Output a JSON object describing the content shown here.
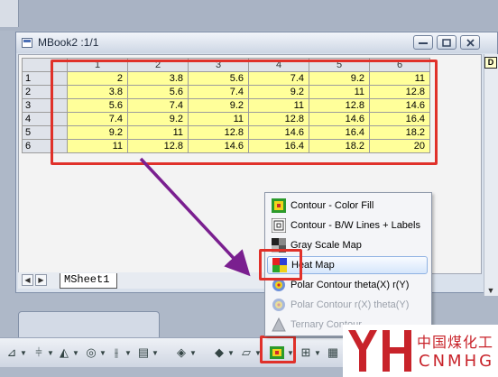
{
  "window": {
    "title": "MBook2 :1/1",
    "d_button": "D",
    "sheet_tab": "MSheet1"
  },
  "sheet": {
    "columns": [
      "1",
      "2",
      "3",
      "4",
      "5",
      "6"
    ],
    "rows": [
      {
        "label": "1",
        "values": [
          "2",
          "3.8",
          "5.6",
          "7.4",
          "9.2",
          "11"
        ]
      },
      {
        "label": "2",
        "values": [
          "3.8",
          "5.6",
          "7.4",
          "9.2",
          "11",
          "12.8"
        ]
      },
      {
        "label": "3",
        "values": [
          "5.6",
          "7.4",
          "9.2",
          "11",
          "12.8",
          "14.6"
        ]
      },
      {
        "label": "4",
        "values": [
          "7.4",
          "9.2",
          "11",
          "12.8",
          "14.6",
          "16.4"
        ]
      },
      {
        "label": "5",
        "values": [
          "9.2",
          "11",
          "12.8",
          "14.6",
          "16.4",
          "18.2"
        ]
      },
      {
        "label": "6",
        "values": [
          "11",
          "12.8",
          "14.6",
          "16.4",
          "18.2",
          "20"
        ]
      }
    ]
  },
  "menu": {
    "items": [
      {
        "label": "Contour - Color Fill",
        "icon": "contour-color-fill-icon",
        "enabled": true,
        "highlighted": false
      },
      {
        "label": "Contour - B/W Lines + Labels",
        "icon": "contour-bw-lines-icon",
        "enabled": true,
        "highlighted": false
      },
      {
        "label": "Gray Scale Map",
        "icon": "gray-scale-map-icon",
        "enabled": true,
        "highlighted": false
      },
      {
        "label": "Heat Map",
        "icon": "heat-map-icon",
        "enabled": true,
        "highlighted": true
      },
      {
        "label": "Polar Contour theta(X) r(Y)",
        "icon": "polar-contour-icon",
        "enabled": true,
        "highlighted": false
      },
      {
        "label": "Polar Contour r(X) theta(Y)",
        "icon": "polar-contour-icon",
        "enabled": false,
        "highlighted": false
      },
      {
        "label": "Ternary Contour",
        "icon": "ternary-contour-icon",
        "enabled": false,
        "highlighted": false
      }
    ]
  },
  "watermark": {
    "chinese": "中国煤化工",
    "latin": "CNMHG",
    "mark": "YH"
  },
  "colors": {
    "highlight_red": "#e0312a",
    "arrow_purple": "#7a1f8f",
    "cell_yellow": "#ffff9a",
    "logo_red": "#c8232a"
  }
}
